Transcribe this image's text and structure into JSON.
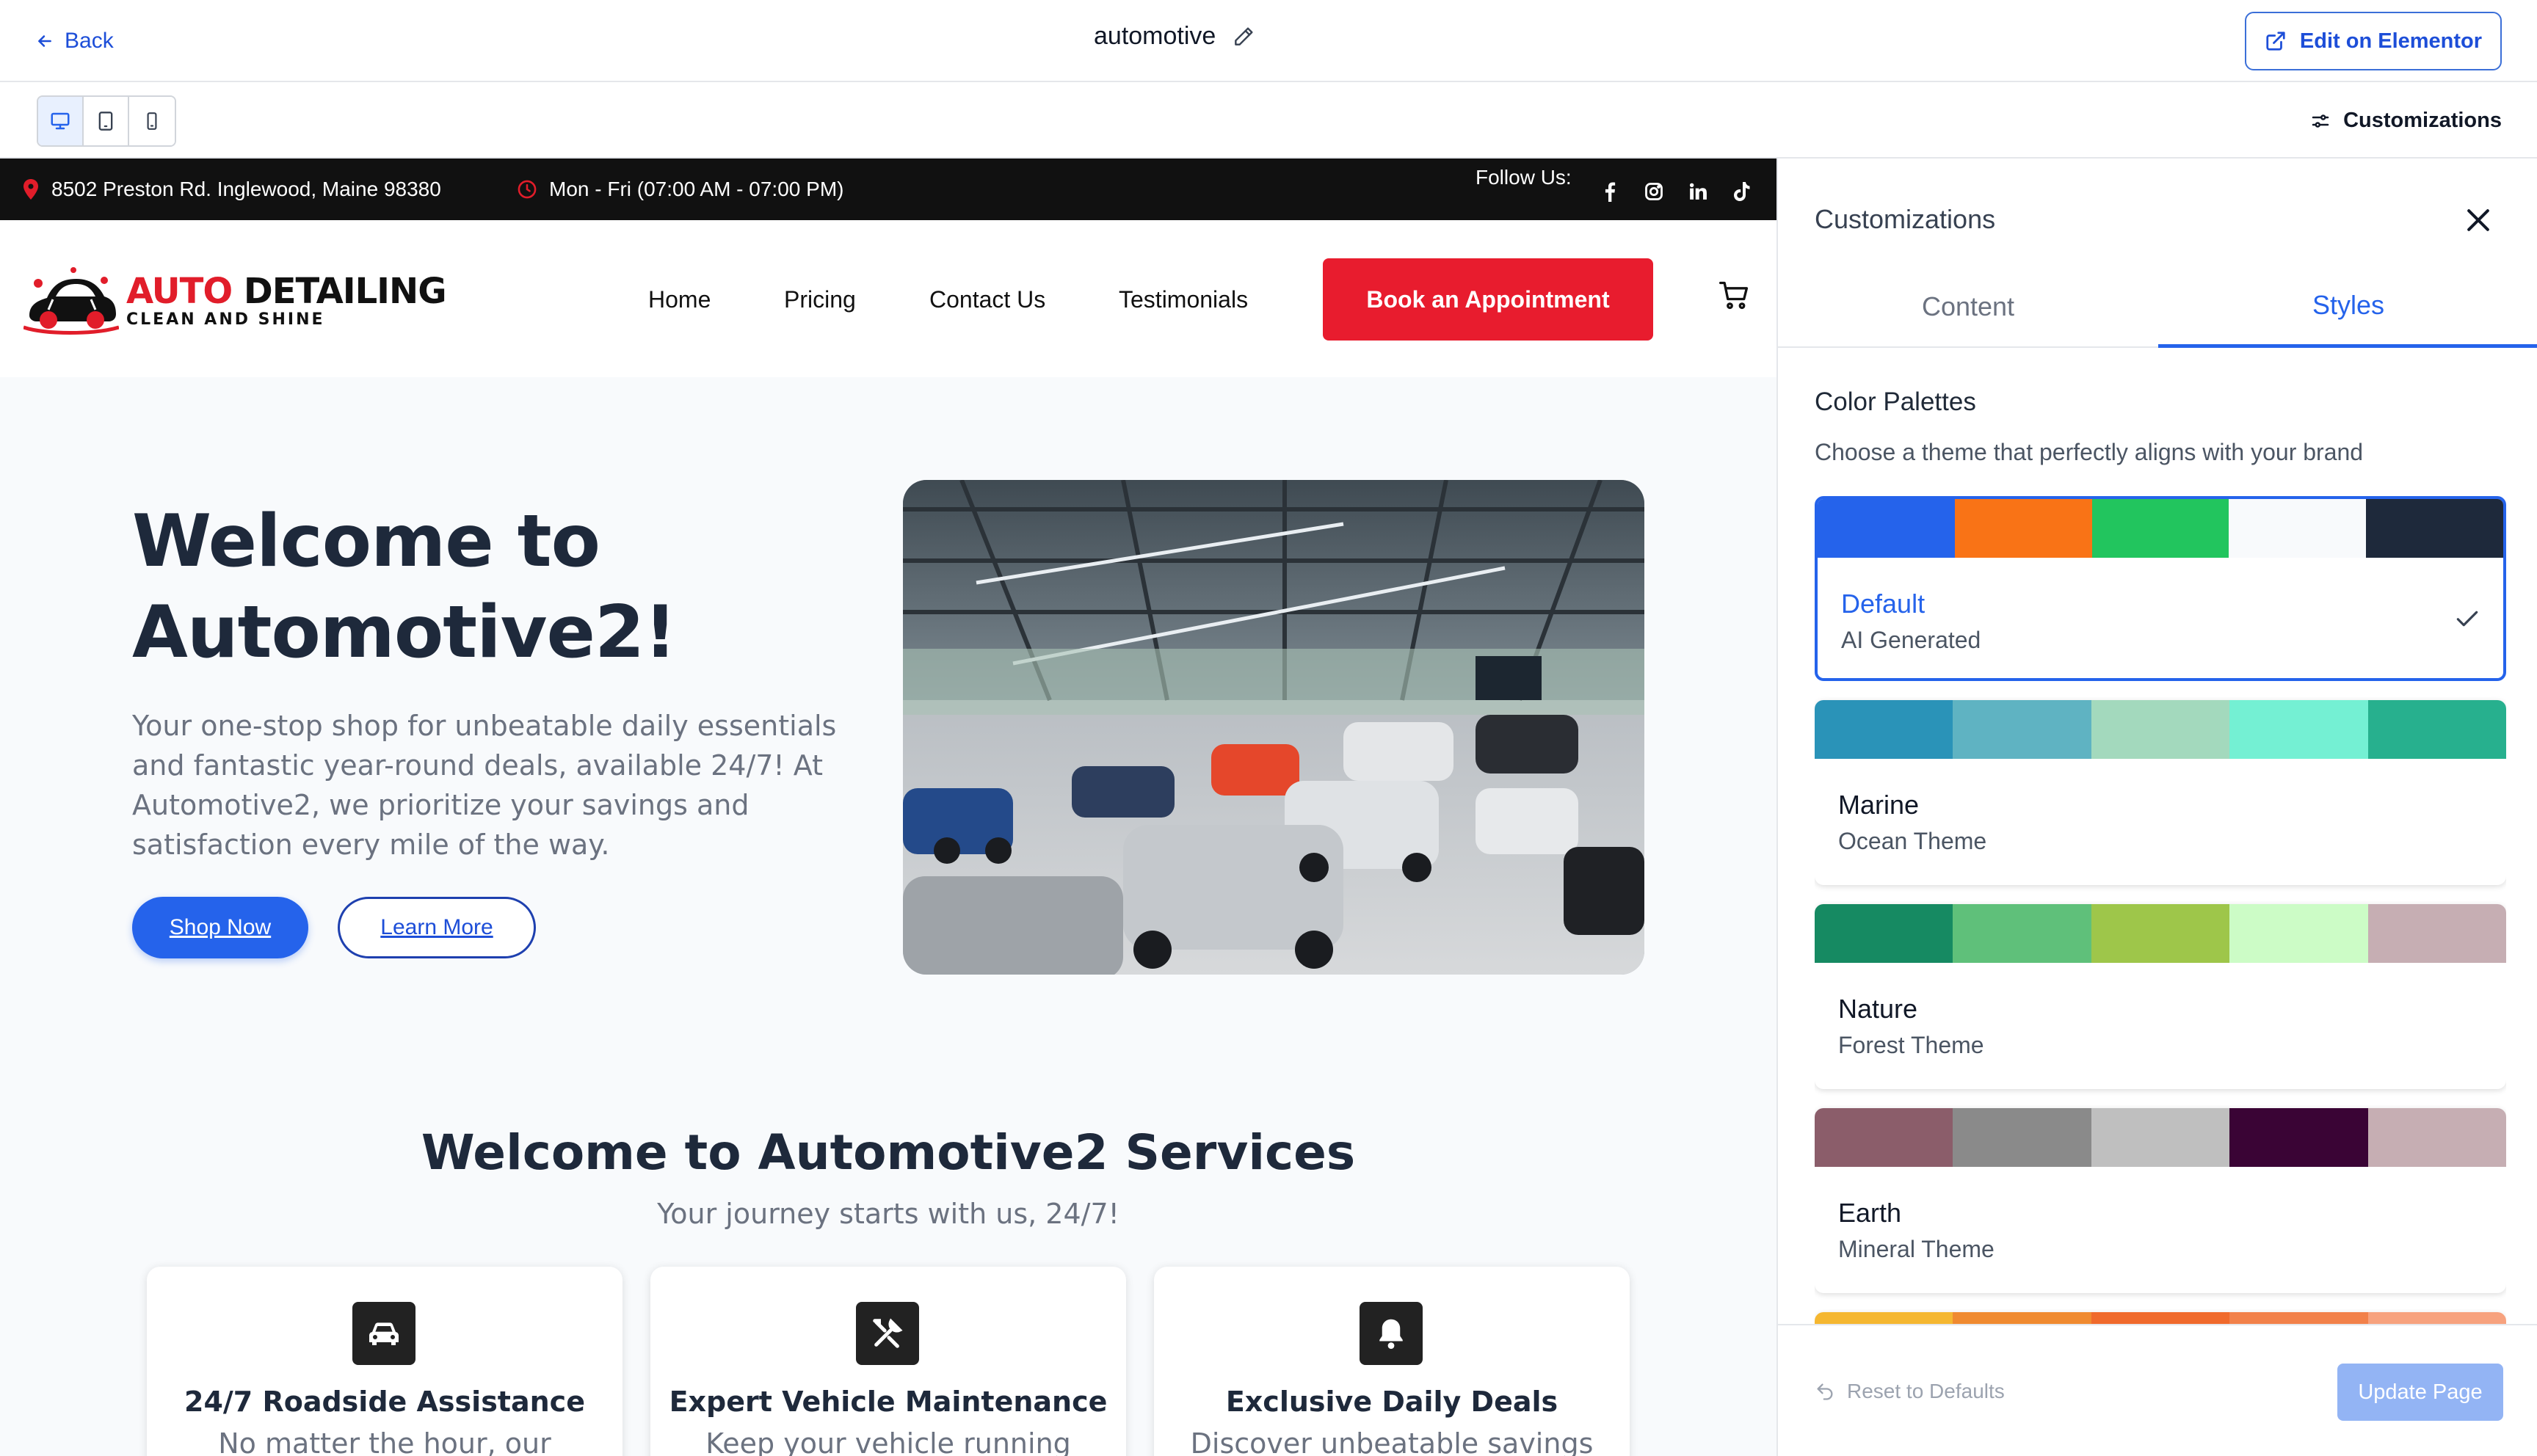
{
  "topbar": {
    "back_label": "Back",
    "title": "automotive",
    "edit_button": "Edit on Elementor"
  },
  "toolbar": {
    "customizations_label": "Customizations",
    "devices": [
      "desktop-icon",
      "tablet-icon",
      "mobile-icon"
    ]
  },
  "site": {
    "info": {
      "address": "8502 Preston Rd. Inglewood, Maine 98380",
      "hours": "Mon - Fri (07:00 AM - 07:00 PM)",
      "follow_label": "Follow Us:",
      "socials": [
        "facebook-icon",
        "instagram-icon",
        "linkedin-icon",
        "tiktok-icon"
      ]
    },
    "logo": {
      "line1_red": "AUTO",
      "line1_black": "DETAILING",
      "line2": "CLEAN AND SHINE"
    },
    "nav": {
      "home": "Home",
      "pricing": "Pricing",
      "contact": "Contact Us",
      "testimonials": "Testimonials",
      "book": "Book an Appointment"
    },
    "hero": {
      "title": "Welcome to Automotive2!",
      "text": "Your one-stop shop for unbeatable daily essentials and fantastic year-round deals, available 24/7! At Automotive2, we prioritize your savings and satisfaction every mile of the way.",
      "shop_button": "Shop Now",
      "learn_button": "Learn More"
    },
    "services": {
      "title": "Welcome to Automotive2 Services",
      "subtitle": "Your journey starts with us, 24/7!",
      "cards": [
        {
          "title": "24/7 Roadside Assistance",
          "text": "No matter the hour, our friendly",
          "icon": "car-icon"
        },
        {
          "title": "Expert Vehicle Maintenance",
          "text": "Keep your vehicle running",
          "icon": "tools-icon"
        },
        {
          "title": "Exclusive Daily Deals",
          "text": "Discover unbeatable savings",
          "icon": "bell-icon"
        }
      ]
    }
  },
  "panel": {
    "title": "Customizations",
    "tabs": {
      "content": "Content",
      "styles": "Styles"
    },
    "active_tab": "Styles",
    "palettes_heading": "Color Palettes",
    "palettes_desc": "Choose a theme that perfectly aligns with your brand",
    "palettes": [
      {
        "name": "Default",
        "sub": "AI Generated",
        "selected": true,
        "colors": [
          "#2563eb",
          "#f97316",
          "#22c55e",
          "#f8fafc",
          "#1e293b"
        ]
      },
      {
        "name": "Marine",
        "sub": "Ocean Theme",
        "selected": false,
        "colors": [
          "#2a93b8",
          "#5fb3c2",
          "#a3d9bd",
          "#74f0d3",
          "#27b08e"
        ]
      },
      {
        "name": "Nature",
        "sub": "Forest Theme",
        "selected": false,
        "colors": [
          "#168a62",
          "#5fc07a",
          "#9ec64a",
          "#ccfcc6",
          "#c6aeb3"
        ]
      },
      {
        "name": "Earth",
        "sub": "Mineral Theme",
        "selected": false,
        "colors": [
          "#8b5d6a",
          "#8a8a8a",
          "#bfbfbf",
          "#3a0435",
          "#c6aeb3"
        ]
      },
      {
        "name": "",
        "sub": "",
        "selected": false,
        "colors": [
          "#f5b731",
          "#f08a30",
          "#f06a2c",
          "#f2814a",
          "#f7a27e"
        ]
      }
    ],
    "reset_label": "Reset to Defaults",
    "update_label": "Update Page"
  }
}
